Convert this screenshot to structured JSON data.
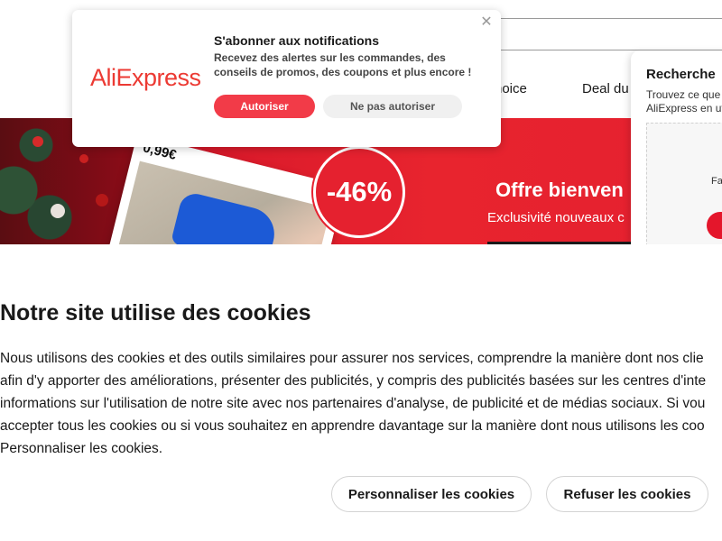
{
  "header": {
    "nav_choice": "hoice",
    "nav_deal": "Deal du"
  },
  "hero": {
    "price": "0,99€",
    "discount": "-46%",
    "title": "Offre bienven",
    "subtitle": "Exclusivité nouveaux c"
  },
  "side_panel": {
    "title": "Recherche",
    "text_line1": "Trouvez ce que",
    "text_line2": "AliExpress en ut",
    "box_text": "Fa"
  },
  "notification": {
    "logo": "AliExpress",
    "title": "S'abonner aux notifications",
    "description": "Recevez des alertes sur les commandes, des conseils de promos, des coupons et plus encore !",
    "allow_label": "Autoriser",
    "deny_label": "Ne pas autoriser",
    "close_icon": "close-icon"
  },
  "cookie_banner": {
    "title": "Notre site utilise des cookies",
    "lines": [
      "Nous utilisons des cookies et des outils similaires pour assurer nos services, comprendre la manière dont nos clie",
      "afin d'y apporter des améliorations, présenter des publicités, y compris des publicités basées sur les centres d'inte",
      "informations sur l'utilisation de notre site avec nos partenaires d'analyse, de publicité et de médias sociaux. Si vou",
      "accepter tous les cookies ou si vous souhaitez en apprendre davantage sur la manière dont nous utilisons les coo",
      "Personnaliser les cookies."
    ],
    "personalize_label": "Personnaliser les cookies",
    "refuse_label": "Refuser les cookies"
  },
  "colors": {
    "brand_red": "#e5212f",
    "allow_button": "#f23b48"
  }
}
